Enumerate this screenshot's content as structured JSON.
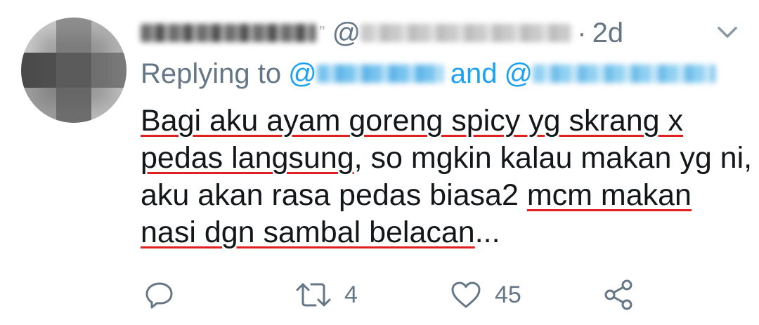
{
  "tweet": {
    "author": {
      "name_mark": "ˮ",
      "at_sign": "@"
    },
    "separator": "·",
    "time": "2d",
    "reply": {
      "prefix": "Replying to",
      "at_sign_1": "@",
      "conjunction": "and",
      "at_sign_2": "@"
    },
    "body": {
      "line1": "Bagi aku ayam goreng spicy yg skrang x",
      "line2_underlined": "pedas langsung",
      "line2_rest": ", so mgkin kalau makan yg ni,",
      "line3_plain": "aku akan rasa pedas biasa2 ",
      "line3_underlined": "mcm makan",
      "line4_underlined": "nasi dgn sambal belacan",
      "line4_rest": "..."
    },
    "actions": {
      "retweet_count": "4",
      "like_count": "45"
    },
    "icons": {
      "menu": "chevron-down-icon",
      "reply": "reply-icon",
      "retweet": "retweet-icon",
      "like": "heart-icon",
      "share": "share-icon"
    },
    "colors": {
      "text": "#14171a",
      "secondary": "#657786",
      "link": "#1da1f2",
      "underline": "#e0201e"
    }
  }
}
